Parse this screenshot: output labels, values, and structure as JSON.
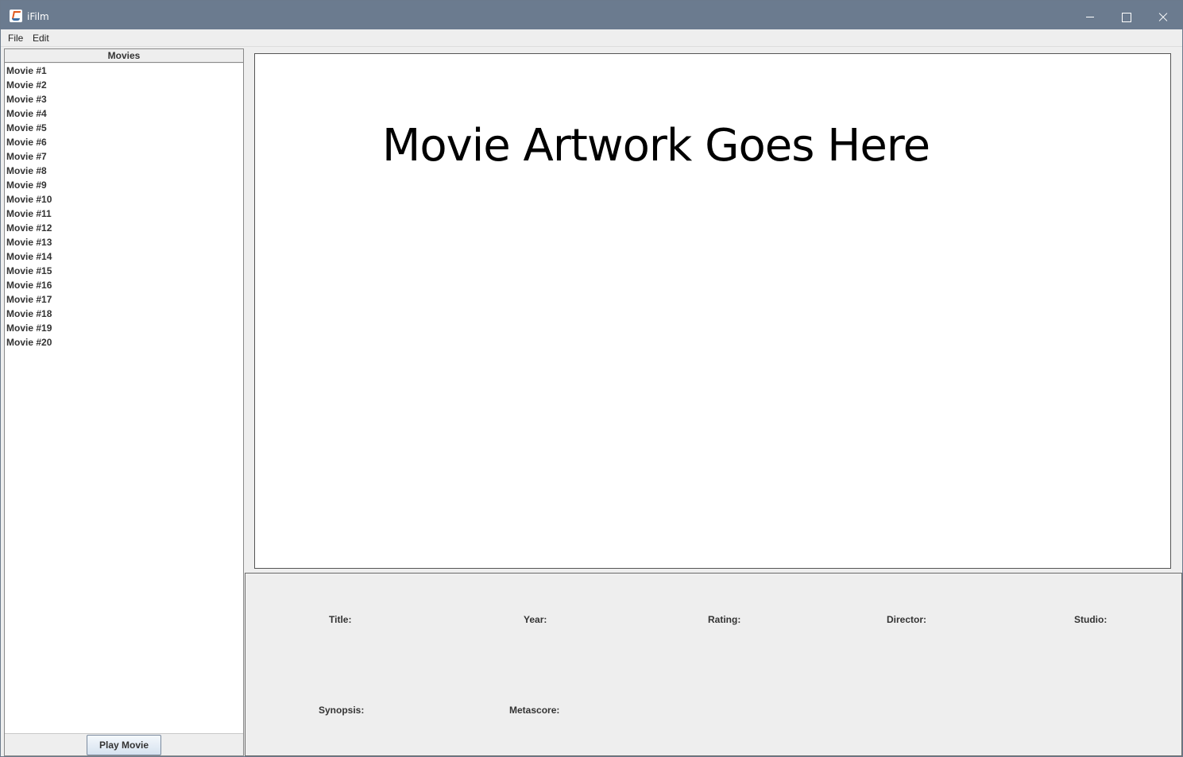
{
  "window": {
    "title": "iFilm"
  },
  "menu": {
    "file": "File",
    "edit": "Edit"
  },
  "movies": {
    "header": "Movies",
    "items": [
      "Movie #1",
      "Movie #2",
      "Movie #3",
      "Movie #4",
      "Movie #5",
      "Movie #6",
      "Movie #7",
      "Movie #8",
      "Movie #9",
      "Movie #10",
      "Movie #11",
      "Movie #12",
      "Movie #13",
      "Movie #14",
      "Movie #15",
      "Movie #16",
      "Movie #17",
      "Movie #18",
      "Movie #19",
      "Movie #20"
    ],
    "play_button": "Play Movie"
  },
  "artwork": {
    "placeholder": "Movie Artwork Goes Here"
  },
  "details": {
    "title_label": "Title:",
    "year_label": "Year:",
    "rating_label": "Rating:",
    "director_label": "Director:",
    "studio_label": "Studio:",
    "synopsis_label": "Synopsis:",
    "metascore_label": "Metascore:"
  }
}
